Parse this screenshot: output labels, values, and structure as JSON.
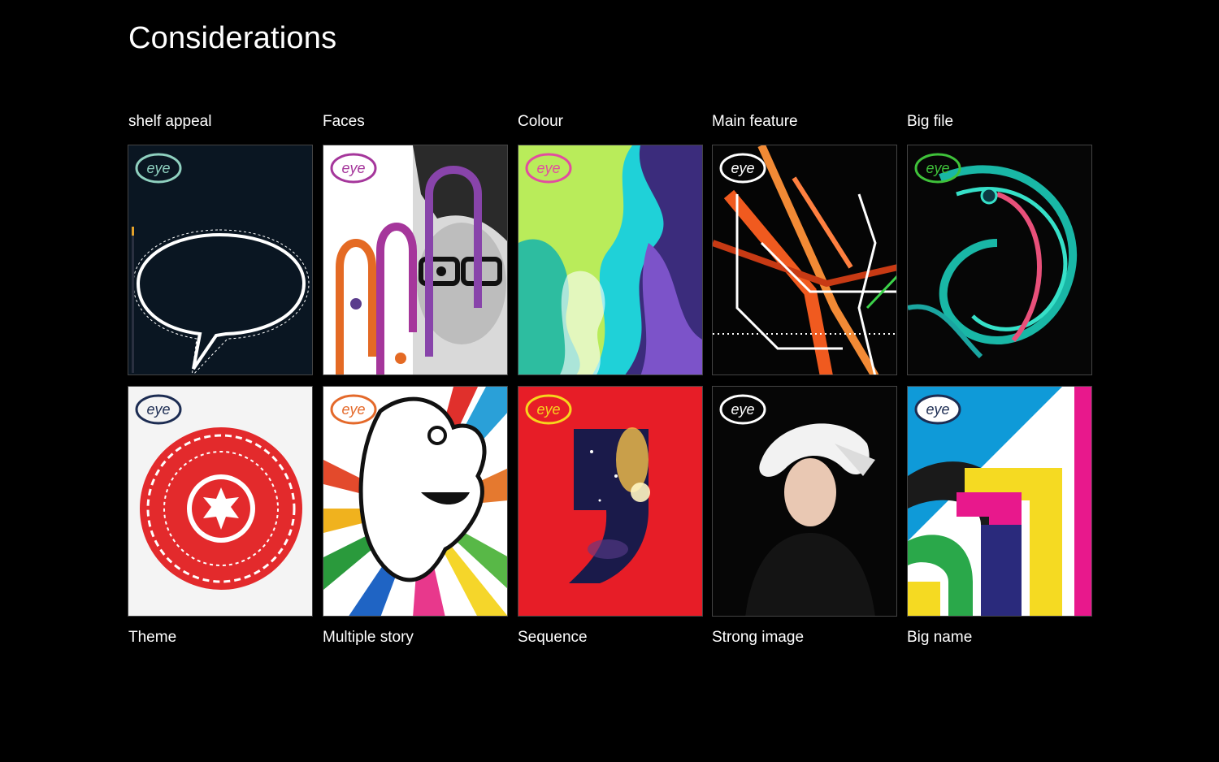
{
  "page": {
    "title": "Considerations"
  },
  "logo_text": "eye",
  "top_row": [
    {
      "label": "shelf appeal",
      "logo_color": "#8fd1c0",
      "bg": "#0a1622"
    },
    {
      "label": "Faces",
      "logo_color": "#a5369b",
      "bg": "#ffffff"
    },
    {
      "label": "Colour",
      "logo_color": "#e24ca0",
      "bg": "#1fd1d8"
    },
    {
      "label": "Main feature",
      "logo_color": "#ffffff",
      "bg": "#050505"
    },
    {
      "label": "Big file",
      "logo_color": "#3fc23a",
      "bg": "#060606"
    }
  ],
  "bottom_row": [
    {
      "label": "Theme",
      "logo_color": "#1c2c52",
      "bg": "#f4f4f4"
    },
    {
      "label": "Multiple story",
      "logo_color": "#e4692a",
      "bg": "#ffffff"
    },
    {
      "label": "Sequence",
      "logo_color": "#f7d51d",
      "bg": "#e71d27"
    },
    {
      "label": "Strong image",
      "logo_color": "#ffffff",
      "bg": "#060606"
    },
    {
      "label": "Big name",
      "logo_color": "#1c2c52",
      "bg": "#ffffff"
    }
  ]
}
